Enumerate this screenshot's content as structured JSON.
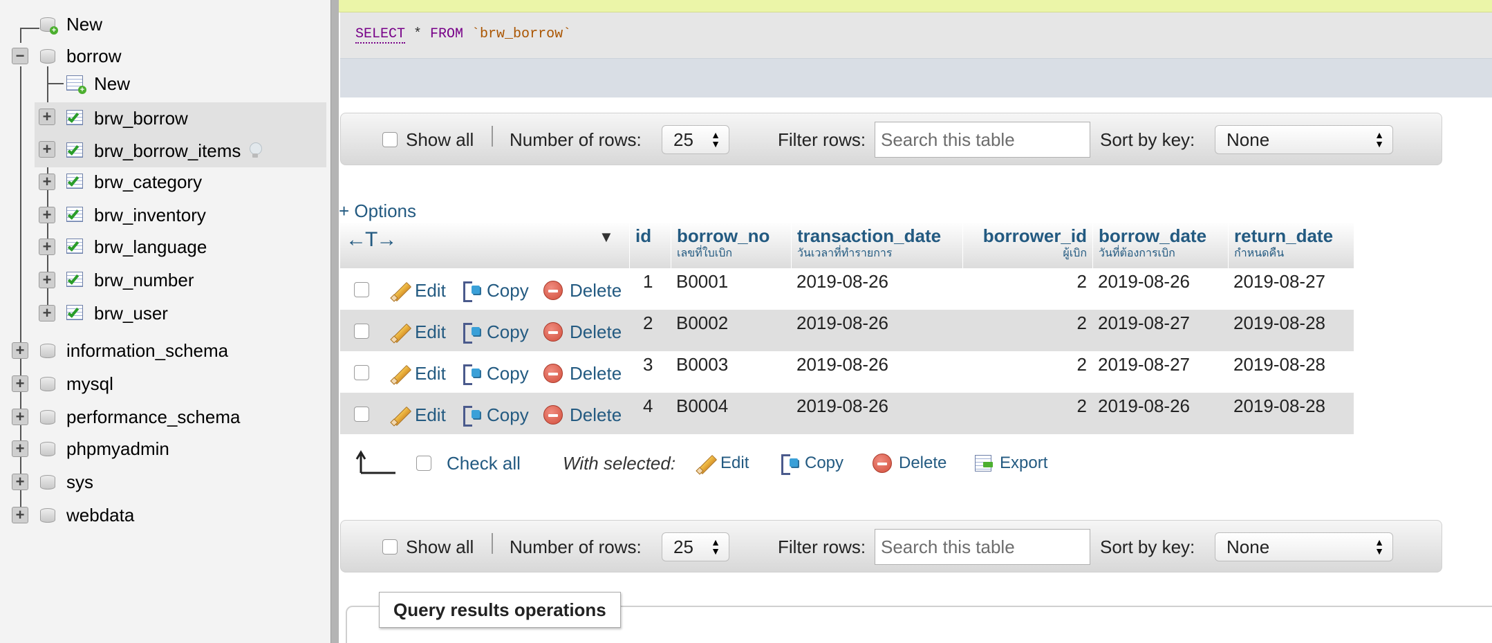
{
  "sidebar": {
    "new_top": "New",
    "borrow_db": "borrow",
    "new_table": "New",
    "tables": [
      "brw_borrow",
      "brw_borrow_items",
      "brw_category",
      "brw_inventory",
      "brw_language",
      "brw_number",
      "brw_user"
    ],
    "databases": [
      "information_schema",
      "mysql",
      "performance_schema",
      "phpmyadmin",
      "sys",
      "webdata"
    ],
    "expand_symbol": "+",
    "collapse_symbol": "−"
  },
  "query": {
    "keyword_select": "SELECT",
    "star": " * ",
    "keyword_from": "FROM",
    "table": " `brw_borrow`"
  },
  "navigation": {
    "show_all_label": "Show all",
    "rows_label": "Number of rows:",
    "rows_value": "25",
    "filter_label": "Filter rows:",
    "filter_placeholder": "Search this table",
    "sort_label": "Sort by key:",
    "sort_value": "None"
  },
  "options_link": "+ Options",
  "table": {
    "column_arrows": "←T→",
    "columns": [
      {
        "name": "id",
        "comment": ""
      },
      {
        "name": "borrow_no",
        "comment": "เลขที่ใบเบิก"
      },
      {
        "name": "transaction_date",
        "comment": "วันเวลาที่ทำรายการ"
      },
      {
        "name": "borrower_id",
        "comment": "ผู้เบิก"
      },
      {
        "name": "borrow_date",
        "comment": "วันที่ต้องการเบิก"
      },
      {
        "name": "return_date",
        "comment": "กำหนดคืน"
      }
    ],
    "action_labels": {
      "edit": "Edit",
      "copy": "Copy",
      "delete": "Delete"
    },
    "rows": [
      {
        "id": "1",
        "borrow_no": "B0001",
        "transaction_date": "2019-08-26",
        "borrower_id": "2",
        "borrow_date": "2019-08-26",
        "return_date": "2019-08-27"
      },
      {
        "id": "2",
        "borrow_no": "B0002",
        "transaction_date": "2019-08-26",
        "borrower_id": "2",
        "borrow_date": "2019-08-27",
        "return_date": "2019-08-28"
      },
      {
        "id": "3",
        "borrow_no": "B0003",
        "transaction_date": "2019-08-26",
        "borrower_id": "2",
        "borrow_date": "2019-08-27",
        "return_date": "2019-08-28"
      },
      {
        "id": "4",
        "borrow_no": "B0004",
        "transaction_date": "2019-08-26",
        "borrower_id": "2",
        "borrow_date": "2019-08-26",
        "return_date": "2019-08-28"
      }
    ]
  },
  "bulk": {
    "check_all": "Check all",
    "with_selected": "With selected:",
    "edit": "Edit",
    "copy": "Copy",
    "delete": "Delete",
    "export": "Export"
  },
  "operations": {
    "title": "Query results operations"
  }
}
